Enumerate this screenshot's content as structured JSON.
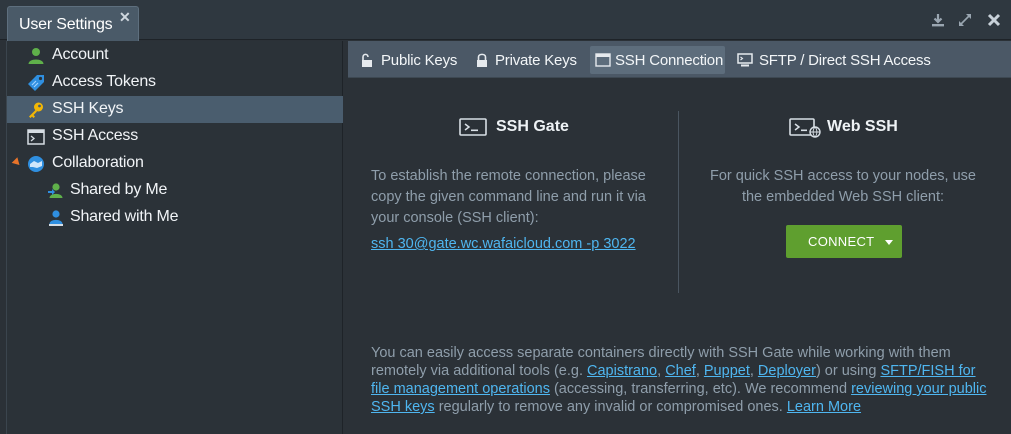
{
  "window": {
    "tab_title": "User Settings",
    "close_symbol": "✕"
  },
  "sidebar": {
    "items": [
      {
        "label": "Account",
        "icon": "user-icon",
        "selected": false
      },
      {
        "label": "Access Tokens",
        "icon": "tag-icon",
        "selected": false
      },
      {
        "label": "SSH Keys",
        "icon": "key-icon",
        "selected": true
      },
      {
        "label": "SSH Access",
        "icon": "terminal-window-icon",
        "selected": false
      },
      {
        "label": "Collaboration",
        "icon": "handshake-icon",
        "selected": false,
        "expanded": true
      },
      {
        "label": "Shared by Me",
        "icon": "shared-user-icon",
        "selected": false
      },
      {
        "label": "Shared with Me",
        "icon": "received-user-icon",
        "selected": false
      }
    ]
  },
  "subtabs": [
    {
      "label": "Public Keys",
      "icon": "unlocked-icon",
      "active": false
    },
    {
      "label": "Private Keys",
      "icon": "lock-icon",
      "active": false
    },
    {
      "label": "SSH Connection",
      "icon": "window-icon",
      "active": true
    },
    {
      "label": "SFTP / Direct SSH Access",
      "icon": "monitor-icon",
      "active": false
    }
  ],
  "ssh_gate": {
    "title": "SSH Gate",
    "line1": "To establish the remote connection, please",
    "line2": "copy the given command line and run it via",
    "line3": "your console (SSH client):",
    "command": "ssh 30@gate.wc.wafaicloud.com -p 3022"
  },
  "web_ssh": {
    "title": "Web SSH",
    "line1": "For quick SSH access to your nodes, use",
    "line2": "the embedded Web SSH client:",
    "button_label": "CONNECT"
  },
  "footer": {
    "t1": "You can easily access separate containers directly with SSH Gate while working with them remotely via additional tools (e.g. ",
    "link_capistrano": "Capistrano",
    "sep1": ", ",
    "link_chef": "Chef",
    "sep2": ", ",
    "link_puppet": "Puppet",
    "sep3": ", ",
    "link_deployer": "Deployer",
    "t2": ") or using ",
    "link_sftp": "SFTP/FISH for file management operations",
    "t3": " (accessing, transferring, etc). We recommend ",
    "link_review": "reviewing your public SSH keys",
    "t4": " regularly to remove any invalid or compromised ones. ",
    "link_learn": "Learn More"
  },
  "colors": {
    "accent_link": "#4fb6f0",
    "connect_green": "#5f9f2f",
    "selected_row": "#4a5d6e",
    "expander_orange": "#e8742a"
  }
}
